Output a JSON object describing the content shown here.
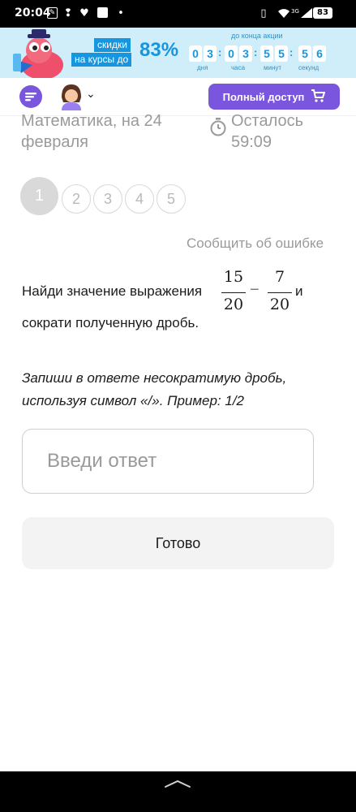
{
  "status_bar": {
    "time": "20:04",
    "network": "3G",
    "battery": "83"
  },
  "promo": {
    "line1": "скидки",
    "line2": "на курсы до",
    "percent": "83%",
    "caption": "до конца акции",
    "countdown": {
      "days": [
        "0",
        "3"
      ],
      "hours": [
        "0",
        "3"
      ],
      "minutes": [
        "5",
        "5"
      ],
      "seconds": [
        "5",
        "6"
      ]
    },
    "units": {
      "days": "дня",
      "hours": "часа",
      "minutes": "минут",
      "seconds": "секунд"
    }
  },
  "header": {
    "cta_label": "Полный доступ"
  },
  "info": {
    "subject_line1": "Математика, на 24",
    "subject_line2": "февраля",
    "timer_line1": "Осталось",
    "timer_line2": "59:09"
  },
  "steps": [
    "1",
    "2",
    "3",
    "4",
    "5"
  ],
  "active_step": 1,
  "report_link": "Сообщить об ошибке",
  "task": {
    "prefix": "Найди значение выражения",
    "fraction1": {
      "numerator": "15",
      "denominator": "20"
    },
    "operator": "−",
    "fraction2": {
      "numerator": "7",
      "denominator": "20"
    },
    "suffix": "и",
    "line2": "сократи полученную дробь."
  },
  "hint": {
    "line1": "Запиши в ответе несократимую дробь,",
    "line2": "используя символ «/». Пример: 1/2"
  },
  "answer": {
    "placeholder": "Введи ответ",
    "value": ""
  },
  "done_label": "Готово",
  "colors": {
    "accent": "#7a55dd",
    "promo_blue": "#1596de",
    "promo_bg": "#cfeefa",
    "muted": "#9a9a9a"
  }
}
